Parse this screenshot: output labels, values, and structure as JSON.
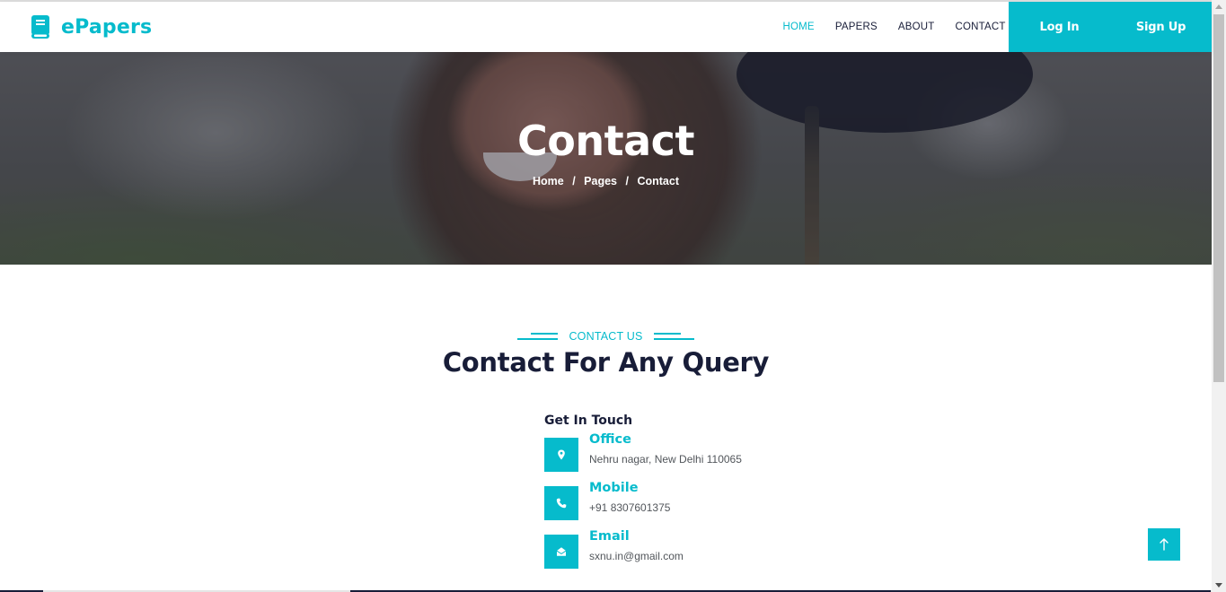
{
  "brand": {
    "name": "ePapers",
    "icon": "book-icon"
  },
  "nav": {
    "links": [
      {
        "label": "HOME",
        "active": true
      },
      {
        "label": "PAPERS",
        "active": false
      },
      {
        "label": "ABOUT",
        "active": false
      },
      {
        "label": "CONTACT",
        "active": false
      }
    ],
    "login_label": "Log In",
    "signup_label": "Sign Up"
  },
  "hero": {
    "title": "Contact",
    "breadcrumb": [
      "Home",
      "Pages",
      "Contact"
    ],
    "separator": "/"
  },
  "section": {
    "tag": "CONTACT US",
    "title": "Contact For Any Query",
    "subtitle": "Get In Touch"
  },
  "contacts": [
    {
      "label": "Office",
      "value": "Nehru nagar, New Delhi 110065",
      "icon": "map-marker-icon"
    },
    {
      "label": "Mobile",
      "value": "+91 8307601375",
      "icon": "phone-icon"
    },
    {
      "label": "Email",
      "value": "sxnu.in@gmail.com",
      "icon": "envelope-open-icon"
    }
  ],
  "colors": {
    "primary": "#06bbcc",
    "dark": "#181d38",
    "text": "#52565b"
  },
  "back_to_top": {
    "icon": "arrow-up-icon"
  }
}
